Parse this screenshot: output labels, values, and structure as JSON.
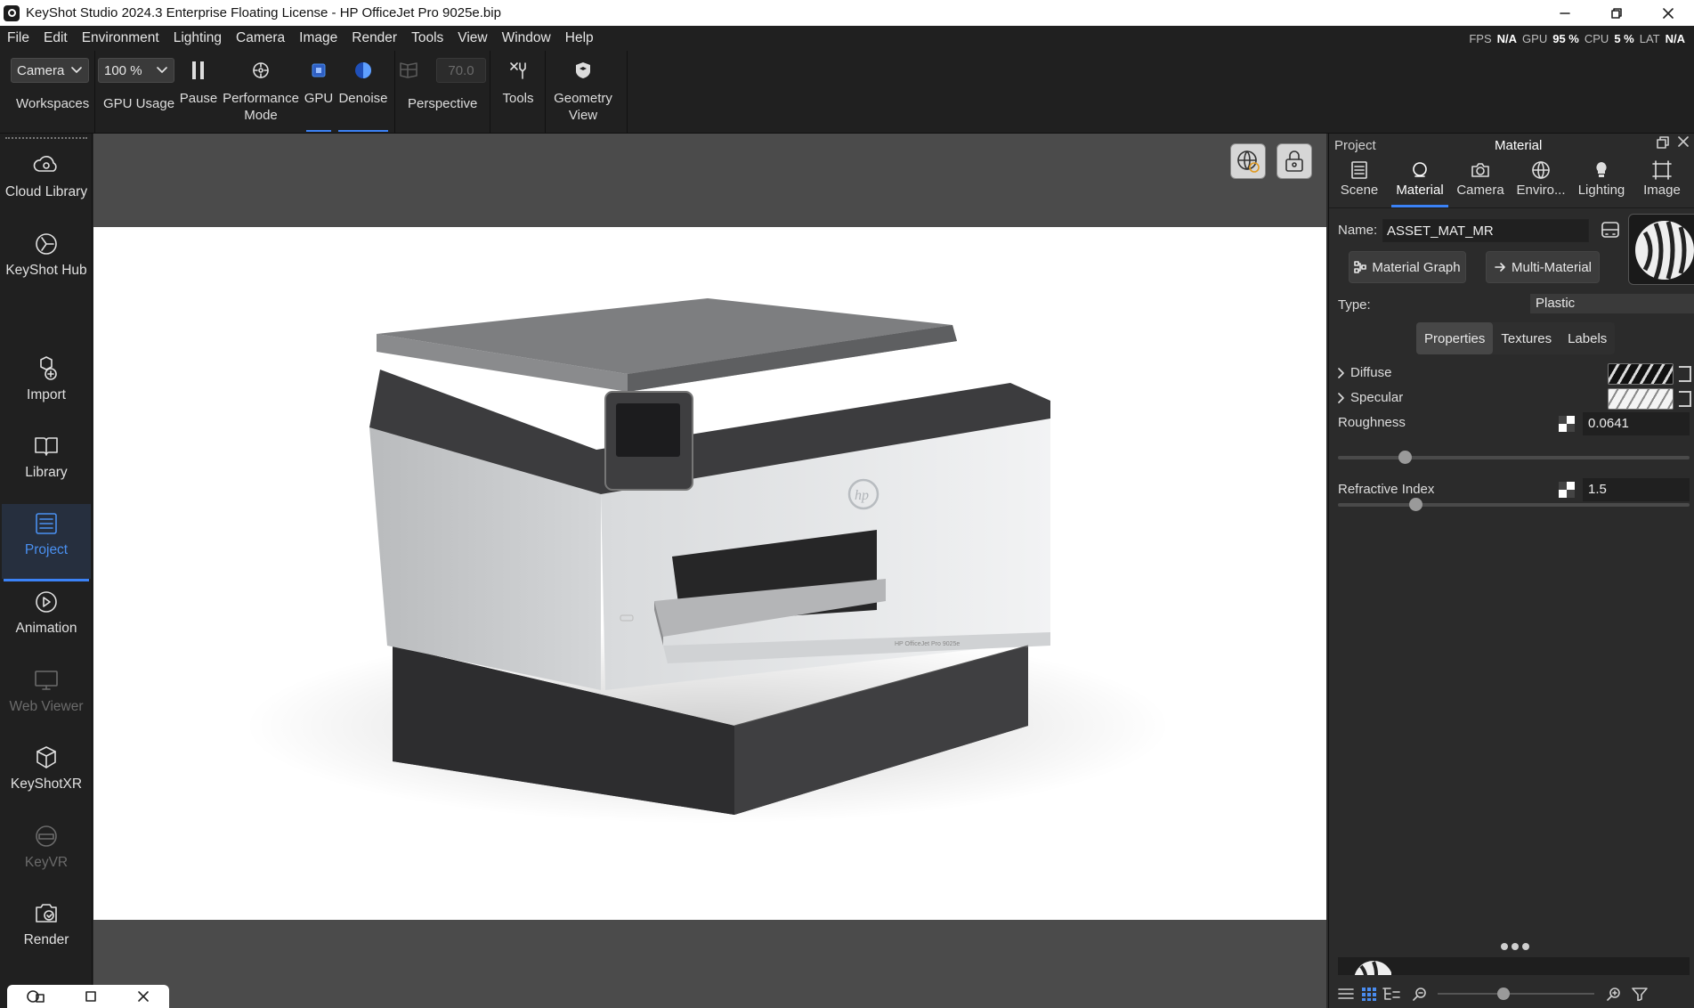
{
  "window": {
    "title": "KeyShot Studio 2024.3 Enterprise Floating License - HP OfficeJet Pro 9025e.bip"
  },
  "menu": [
    "File",
    "Edit",
    "Environment",
    "Lighting",
    "Camera",
    "Image",
    "Render",
    "Tools",
    "View",
    "Window",
    "Help"
  ],
  "perf": {
    "fps_label": "FPS",
    "fps_value": "N/A",
    "gpu_label": "GPU",
    "gpu_value": "95 %",
    "cpu_label": "CPU",
    "cpu_value": "5 %",
    "lat_label": "LAT",
    "lat_value": "N/A"
  },
  "toolbar": {
    "workspace_select": "Camera",
    "workspaces_label": "Workspaces",
    "gpu_usage_select": "100 %",
    "gpu_usage_label": "GPU Usage",
    "pause_label": "Pause",
    "performance_label": "Performance Mode",
    "gpu_label": "GPU",
    "denoise_label": "Denoise",
    "fov_value": "70.0",
    "perspective_label": "Perspective",
    "tools_label": "Tools",
    "geometry_label": "Geometry View",
    "accent_color": "#3b82f6"
  },
  "sidebar": {
    "items": [
      {
        "label": "Cloud Library",
        "icon": "cloud-gear-icon"
      },
      {
        "label": "KeyShot Hub",
        "icon": "keyshot-logo-icon"
      },
      {
        "label": "Import",
        "icon": "import-icon"
      },
      {
        "label": "Library",
        "icon": "book-icon"
      },
      {
        "label": "Project",
        "icon": "list-icon",
        "active": true
      },
      {
        "label": "Animation",
        "icon": "play-circle-icon"
      },
      {
        "label": "Web Viewer",
        "icon": "monitor-icon",
        "disabled": true
      },
      {
        "label": "KeyShotXR",
        "icon": "cube-icon"
      },
      {
        "label": "KeyVR",
        "icon": "vr-headset-icon",
        "disabled": true
      },
      {
        "label": "Render",
        "icon": "render-icon"
      }
    ]
  },
  "viewport": {
    "product": "HP OfficeJet Pro 9025e printer",
    "side_label": "HP OfficeJet Pro 9025e"
  },
  "panel": {
    "title": "Project",
    "subtitle": "Material",
    "tabs": [
      {
        "label": "Scene",
        "icon": "scene-list-icon"
      },
      {
        "label": "Material",
        "icon": "material-ball-icon",
        "active": true
      },
      {
        "label": "Camera",
        "icon": "camera-icon"
      },
      {
        "label": "Enviro...",
        "icon": "globe-icon"
      },
      {
        "label": "Lighting",
        "icon": "bulb-icon"
      },
      {
        "label": "Image",
        "icon": "image-frame-icon"
      }
    ],
    "name_label": "Name:",
    "name_value": "ASSET_MAT_MR",
    "material_graph_label": "Material Graph",
    "multi_material_label": "Multi-Material",
    "type_label": "Type:",
    "type_value": "Plastic",
    "subtabs": [
      "Properties",
      "Textures",
      "Labels"
    ],
    "diffuse_label": "Diffuse",
    "specular_label": "Specular",
    "roughness_label": "Roughness",
    "roughness_value": "0.0641",
    "roughness_pos": 0.19,
    "refractive_label": "Refractive Index",
    "refractive_value": "1.5",
    "refractive_pos": 0.22,
    "zoom_pos": 0.42
  }
}
